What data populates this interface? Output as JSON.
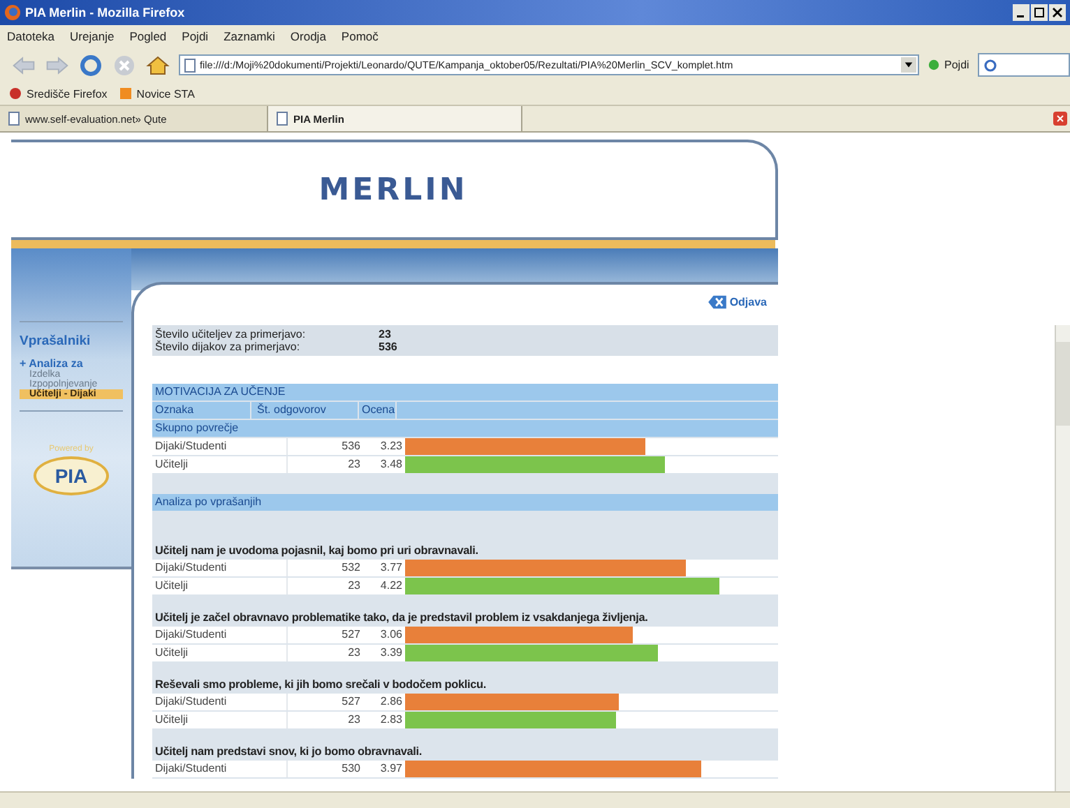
{
  "window": {
    "title": "PIA Merlin - Mozilla Firefox"
  },
  "menu": [
    "Datoteka",
    "Urejanje",
    "Pogled",
    "Pojdi",
    "Zaznamki",
    "Orodja",
    "Pomoč"
  ],
  "toolbar": {
    "url": "file:///d:/Moji%20dokumenti/Projekti/Leonardo/QUTE/Kampanja_oktober05/Rezultati/PIA%20Merlin_SCV_komplet.htm",
    "go": "Pojdi"
  },
  "bookmarks": [
    "Središče Firefox",
    "Novice STA"
  ],
  "tabs": [
    {
      "label": "www.self-evaluation.net» Qute",
      "selected": false
    },
    {
      "label": "PIA Merlin",
      "selected": true
    }
  ],
  "page": {
    "logo": "MERLIN",
    "logout": "Odjava",
    "sidebar": {
      "heading": "Vprašalniki",
      "items": [
        {
          "label": "+ Analiza za",
          "selected": false
        },
        {
          "label": "Izdelka",
          "selected": false
        },
        {
          "label": "Izpopolnjevanje",
          "selected": false
        },
        {
          "label": "Učitelji - Dijaki",
          "selected": true
        }
      ],
      "powered": "Powered by",
      "brand": "PIA"
    },
    "counts": [
      {
        "label": "Število učiteljev za primerjavo:",
        "value": "23"
      },
      {
        "label": "Število dijakov za primerjavo:",
        "value": "536"
      }
    ],
    "section": {
      "title": "MOTIVACIJA ZA UČENJE",
      "columns": [
        "Oznaka",
        "Št. odgovorov",
        "Ocena"
      ],
      "summary_title": "Skupno povrečje",
      "summary_rows": [
        {
          "kind": "students",
          "label": "Dijaki/Studenti",
          "n": "536",
          "score": "3.23",
          "level": 0.646
        },
        {
          "kind": "teachers",
          "label": "Učitelji",
          "n": "23",
          "score": "3.48",
          "level": 0.696
        }
      ],
      "analysis_title": "Analiza po vprašanjih",
      "questions": [
        {
          "text": "Učitelj nam je uvodoma pojasnil, kaj bomo pri uri obravnavali.",
          "rows": [
            {
              "kind": "students",
              "label": "Dijaki/Studenti",
              "n": "532",
              "score": "3.77",
              "level": 0.754
            },
            {
              "kind": "teachers",
              "label": "Učitelji",
              "n": "23",
              "score": "4.22",
              "level": 0.844
            }
          ]
        },
        {
          "text": "Učitelj je začel obravnavo problematike tako, da je predstavil problem iz vsakdanjega življenja.",
          "rows": [
            {
              "kind": "students",
              "label": "Dijaki/Studenti",
              "n": "527",
              "score": "3.06",
              "level": 0.612
            },
            {
              "kind": "teachers",
              "label": "Učitelji",
              "n": "23",
              "score": "3.39",
              "level": 0.678
            }
          ]
        },
        {
          "text": "Reševali smo probleme, ki jih bomo srečali v bodočem poklicu.",
          "rows": [
            {
              "kind": "students",
              "label": "Dijaki/Studenti",
              "n": "527",
              "score": "2.86",
              "level": 0.572
            },
            {
              "kind": "teachers",
              "label": "Učitelji",
              "n": "23",
              "score": "2.83",
              "level": 0.566
            }
          ]
        },
        {
          "text": "Učitelj nam predstavi snov, ki jo bomo obravnavali.",
          "rows": [
            {
              "kind": "students",
              "label": "Dijaki/Studenti",
              "n": "530",
              "score": "3.97",
              "level": 0.794
            }
          ]
        }
      ]
    }
  }
}
